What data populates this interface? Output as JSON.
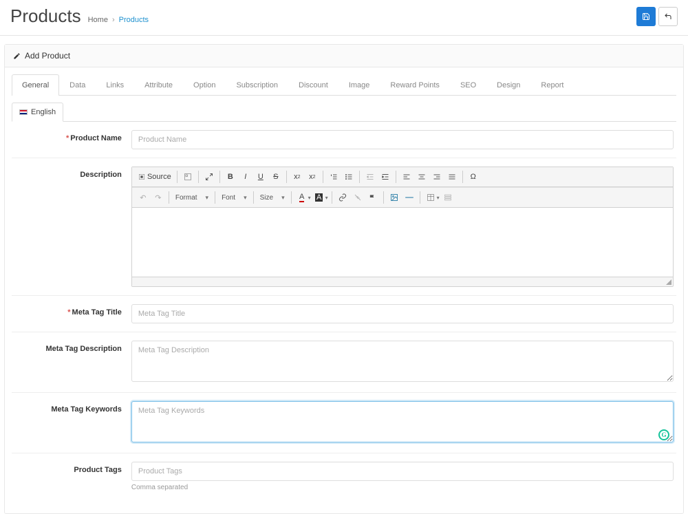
{
  "header": {
    "title": "Products",
    "breadcrumb": {
      "home": "Home",
      "current": "Products"
    }
  },
  "panel": {
    "heading": "Add Product"
  },
  "tabs": {
    "items": [
      {
        "label": "General",
        "active": true
      },
      {
        "label": "Data"
      },
      {
        "label": "Links"
      },
      {
        "label": "Attribute"
      },
      {
        "label": "Option"
      },
      {
        "label": "Subscription"
      },
      {
        "label": "Discount"
      },
      {
        "label": "Image"
      },
      {
        "label": "Reward Points"
      },
      {
        "label": "SEO"
      },
      {
        "label": "Design"
      },
      {
        "label": "Report"
      }
    ]
  },
  "lang": {
    "english": "English"
  },
  "form": {
    "productName": {
      "label": "Product Name",
      "placeholder": "Product Name",
      "required": true
    },
    "description": {
      "label": "Description"
    },
    "metaTitle": {
      "label": "Meta Tag Title",
      "placeholder": "Meta Tag Title",
      "required": true
    },
    "metaDescription": {
      "label": "Meta Tag Description",
      "placeholder": "Meta Tag Description"
    },
    "metaKeywords": {
      "label": "Meta Tag Keywords",
      "placeholder": "Meta Tag Keywords"
    },
    "productTags": {
      "label": "Product Tags",
      "placeholder": "Product Tags",
      "help": "Comma separated"
    }
  },
  "editor": {
    "source": "Source",
    "format": "Format",
    "font": "Font",
    "size": "Size"
  }
}
